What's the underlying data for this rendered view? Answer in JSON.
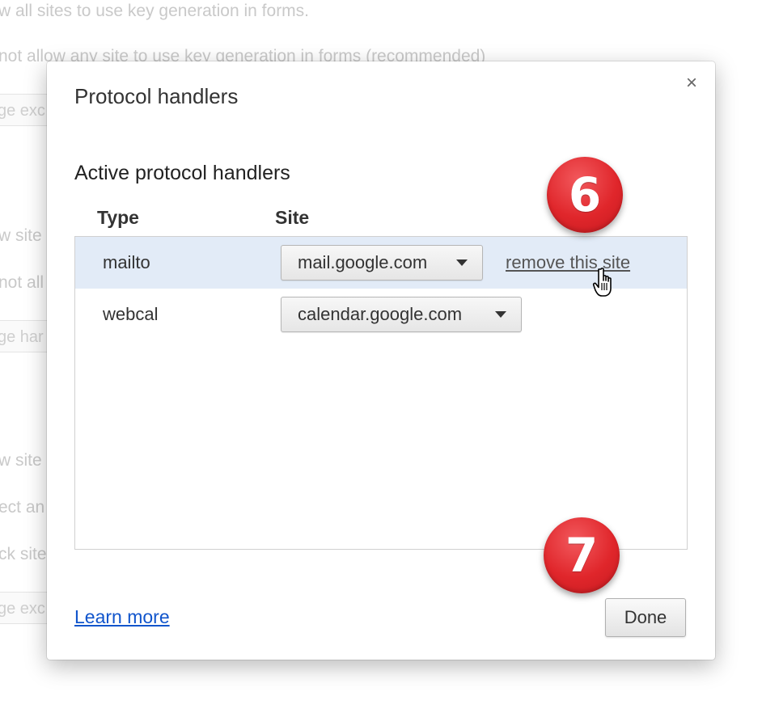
{
  "background": {
    "lines": [
      "w all sites to use key generation in forms.",
      "not allow any site to use key generation in forms (recommended)",
      "w site",
      "not all",
      "w site",
      "ect an",
      "ck site"
    ],
    "buttons": [
      "ge exc",
      "ge har",
      "ge exc"
    ]
  },
  "dialog": {
    "title": "Protocol handlers",
    "close_symbol": "×",
    "section_title": "Active protocol handlers",
    "columns": {
      "type": "Type",
      "site": "Site"
    },
    "handlers": [
      {
        "type": "mailto",
        "site": "mail.google.com",
        "selected": true,
        "remove_label": "remove this site"
      },
      {
        "type": "webcal",
        "site": "calendar.google.com",
        "selected": false
      }
    ],
    "learn_more": "Learn more",
    "done_label": "Done"
  },
  "annotations": {
    "step_6": "6",
    "step_7": "7",
    "badge_color": "#e0262b"
  },
  "icons": {
    "close": "close-icon",
    "dropdown": "chevron-down-icon",
    "cursor": "hand-pointer-icon"
  }
}
